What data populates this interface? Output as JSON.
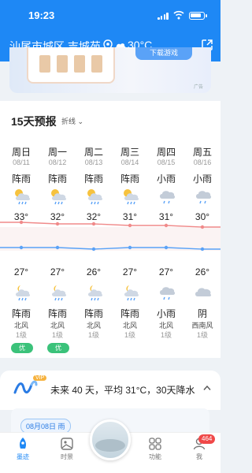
{
  "status_bar": {
    "time": "19:23"
  },
  "header": {
    "location": "汕尾市城区 吉城苑",
    "temperature": "30°C"
  },
  "ad": {
    "button_label": "下载游戏",
    "tag": "广告"
  },
  "forecast": {
    "title": "15天预报",
    "view_toggle": "折线",
    "days": [
      {
        "name": "周日",
        "date": "08/11",
        "day_condition": "阵雨",
        "high": "33°",
        "low": "27°",
        "night_condition": "阵雨",
        "wind": "北风",
        "level": "1级",
        "aqi": "优",
        "icon_day": "thunder-shower-icon",
        "icon_night": "night-shower-icon"
      },
      {
        "name": "周一",
        "date": "08/12",
        "day_condition": "阵雨",
        "high": "32°",
        "low": "27°",
        "night_condition": "阵雨",
        "wind": "北风",
        "level": "1级",
        "aqi": "优",
        "icon_day": "thunder-shower-icon",
        "icon_night": "night-shower-icon"
      },
      {
        "name": "周二",
        "date": "08/13",
        "day_condition": "阵雨",
        "high": "32°",
        "low": "26°",
        "night_condition": "阵雨",
        "wind": "北风",
        "level": "1级",
        "aqi": "",
        "icon_day": "thunder-shower-icon",
        "icon_night": "night-shower-icon"
      },
      {
        "name": "周三",
        "date": "08/14",
        "day_condition": "阵雨",
        "high": "31°",
        "low": "27°",
        "night_condition": "阵雨",
        "wind": "北风",
        "level": "1级",
        "aqi": "",
        "icon_day": "thunder-shower-icon",
        "icon_night": "night-shower-icon"
      },
      {
        "name": "周四",
        "date": "08/15",
        "day_condition": "小雨",
        "high": "31°",
        "low": "27°",
        "night_condition": "小雨",
        "wind": "北风",
        "level": "1级",
        "aqi": "",
        "icon_day": "light-rain-icon",
        "icon_night": "light-rain-icon"
      },
      {
        "name": "周五",
        "date": "08/16",
        "day_condition": "小雨",
        "high": "30°",
        "low": "26°",
        "night_condition": "阴",
        "wind": "西南风",
        "level": "1级",
        "aqi": "",
        "icon_day": "light-rain-icon",
        "icon_night": "overcast-icon"
      }
    ]
  },
  "forty_days": {
    "badge": "VIP",
    "text": "未来 40 天，平均 31°C，30天降水"
  },
  "date_chip": "08月08日 雨",
  "nav": {
    "items": [
      {
        "label": "墨迹",
        "icon": "moji-icon",
        "active": true
      },
      {
        "label": "时景",
        "icon": "gallery-icon",
        "active": false
      },
      {
        "label": "功能",
        "icon": "grid-icon",
        "active": false
      },
      {
        "label": "我",
        "icon": "user-icon",
        "active": false
      }
    ],
    "badge_count": "464"
  },
  "colors": {
    "brand": "#1e88f5",
    "high_line": "#f08a8a",
    "low_line": "#5aa2f7",
    "aqi_good": "#3bc27a"
  }
}
